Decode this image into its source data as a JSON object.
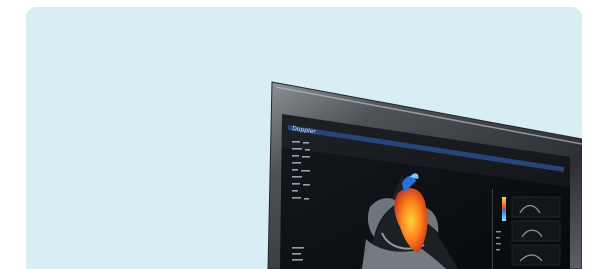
{
  "scene": {
    "subject": "ultrasound-monitor",
    "background_color": "#d9eef4",
    "bezel_color": "#3b3f44",
    "screen_color": "#0c0f13",
    "title_bar_color": "#1d3e77"
  },
  "monitor": {
    "header_text": "Doppler"
  }
}
